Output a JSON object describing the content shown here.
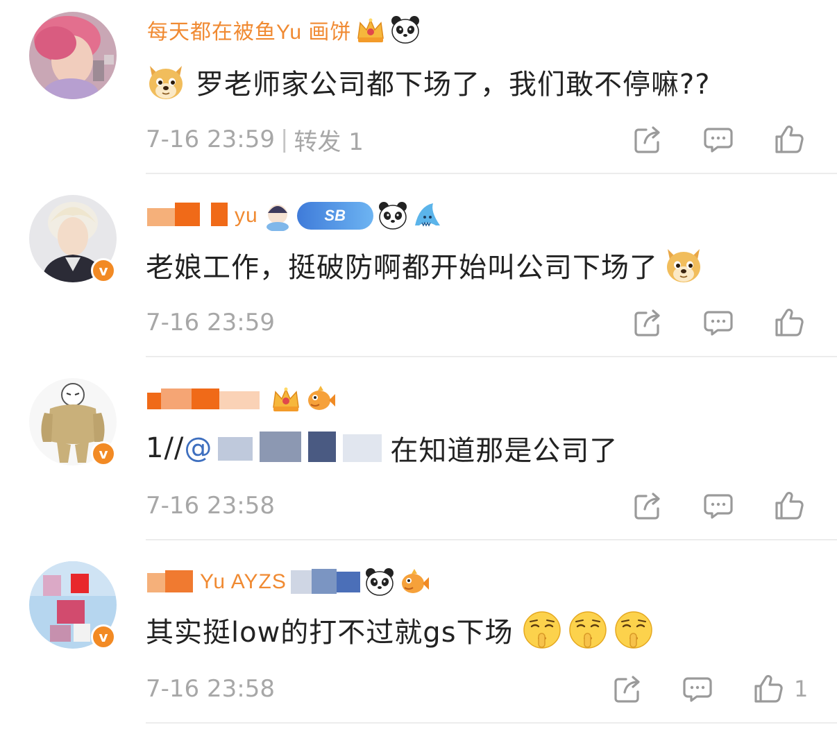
{
  "comments": [
    {
      "username": "每天都在被鱼Yu  画饼",
      "badges": [
        "crown-badge-icon",
        "panda-icon"
      ],
      "text": "罗老师家公司都下场了，我们敢不停嘛??",
      "emoji_prefix": "doge-emoji",
      "timestamp": "7-16 23:59",
      "extra": "转发 1",
      "like_count": "",
      "verified": false
    },
    {
      "username": "yu",
      "badges": [
        "chibi-badge-icon",
        "sb-badge",
        "panda-icon",
        "shark-icon"
      ],
      "sb_label": "SB",
      "text": "老娘工作，挺破防啊都开始叫公司下场了",
      "emoji_suffix": "doge-emoji",
      "timestamp": "7-16 23:59",
      "verified": true
    },
    {
      "username": "",
      "badges": [
        "crown-badge-icon",
        "fish-badge-icon"
      ],
      "text_prefix": "1//",
      "mention": "@",
      "text": "在知道那是公司了",
      "timestamp": "7-16 23:58",
      "verified": true
    },
    {
      "username": "Yu  AYZS",
      "badges": [
        "wave-badge-icon",
        "panda-icon",
        "fish-badge-icon"
      ],
      "text": "其实挺low的打不过就gs下场",
      "emoji_suffix": [
        "shush-emoji",
        "shush-emoji",
        "shush-emoji"
      ],
      "timestamp": "7-16 23:58",
      "like_count": "1",
      "verified": true
    }
  ],
  "colors": {
    "username": "#f08a32",
    "meta": "#a7a7a7",
    "mention": "#3e6fbf",
    "verified_badge": "#f28a24",
    "divider": "#ececec"
  },
  "icons": {
    "share": "share-icon",
    "comment": "comment-icon",
    "like": "like-icon"
  }
}
